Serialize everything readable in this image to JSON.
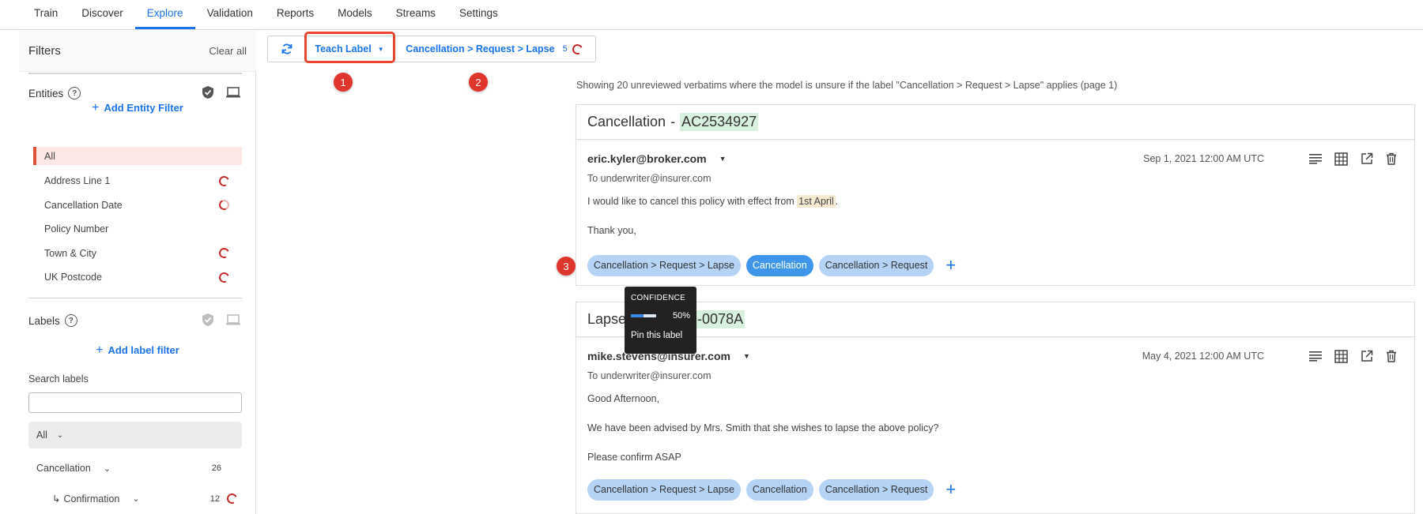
{
  "nav": {
    "tabs": [
      "Train",
      "Discover",
      "Explore",
      "Validation",
      "Reports",
      "Models",
      "Streams",
      "Settings"
    ],
    "active": "Explore"
  },
  "sidebar": {
    "title": "Filters",
    "clear_all": "Clear all",
    "entities": {
      "title": "Entities",
      "help": "?",
      "add_filter": "Add Entity Filter",
      "items": [
        {
          "label": "All",
          "selected": true,
          "spinner": false
        },
        {
          "label": "Address Line 1",
          "spinner": true
        },
        {
          "label": "Cancellation Date",
          "spinner": true
        },
        {
          "label": "Policy Number",
          "spinner": false
        },
        {
          "label": "Town & City",
          "spinner": true
        },
        {
          "label": "UK Postcode",
          "spinner": true
        }
      ]
    },
    "labels": {
      "title": "Labels",
      "help": "?",
      "add_filter": "Add label filter",
      "search_label": "Search labels",
      "search_placeholder": "",
      "select_value": "All",
      "rows": [
        {
          "label": "Cancellation",
          "count": "26"
        },
        {
          "label": "Confirmation",
          "count": "12"
        }
      ]
    }
  },
  "toolbar": {
    "teach": "Teach Label",
    "label_path": "Cancellation > Request > Lapse",
    "count": "5"
  },
  "annotations": [
    "1",
    "2",
    "3"
  ],
  "summary": "Showing 20 unreviewed verbatims where the model is unsure if the label \"Cancellation > Request > Lapse\" applies (page 1)",
  "cards": [
    {
      "title_prefix": "Cancellation",
      "title_sep": "-",
      "title_id": "AC2534927",
      "sender": "eric.kyler@broker.com",
      "date": "Sep 1, 2021 12:00 AM UTC",
      "to": "To underwriter@insurer.com",
      "line1_pre": "I would like to cancel this policy with effect from ",
      "line1_hl": "1st April",
      "line1_post": ".",
      "line2": "Thank you,",
      "labels": [
        "Cancellation > Request > Lapse",
        "Cancellation",
        "Cancellation > Request"
      ]
    },
    {
      "title_prefix": "Lapse",
      "title_id": "-0078A",
      "sender": "mike.stevens@insurer.com",
      "date": "May 4, 2021 12:00 AM UTC",
      "to": "To underwriter@insurer.com",
      "line1": "Good Afternoon,",
      "line2": "We have been advised by Mrs. Smith that she wishes to lapse the above policy?",
      "line3": "Please confirm ASAP",
      "labels": [
        "Cancellation > Request > Lapse",
        "Cancellation",
        "Cancellation > Request"
      ]
    }
  ],
  "tooltip": {
    "caption": "CONFIDENCE",
    "value": 0.5,
    "pct": "50%",
    "action": "Pin this label"
  },
  "colors": {
    "accent": "#1a73e8",
    "chip": "#b5d3f5",
    "chip_strong": "#3f95e9",
    "annotation": "#e0352d"
  }
}
